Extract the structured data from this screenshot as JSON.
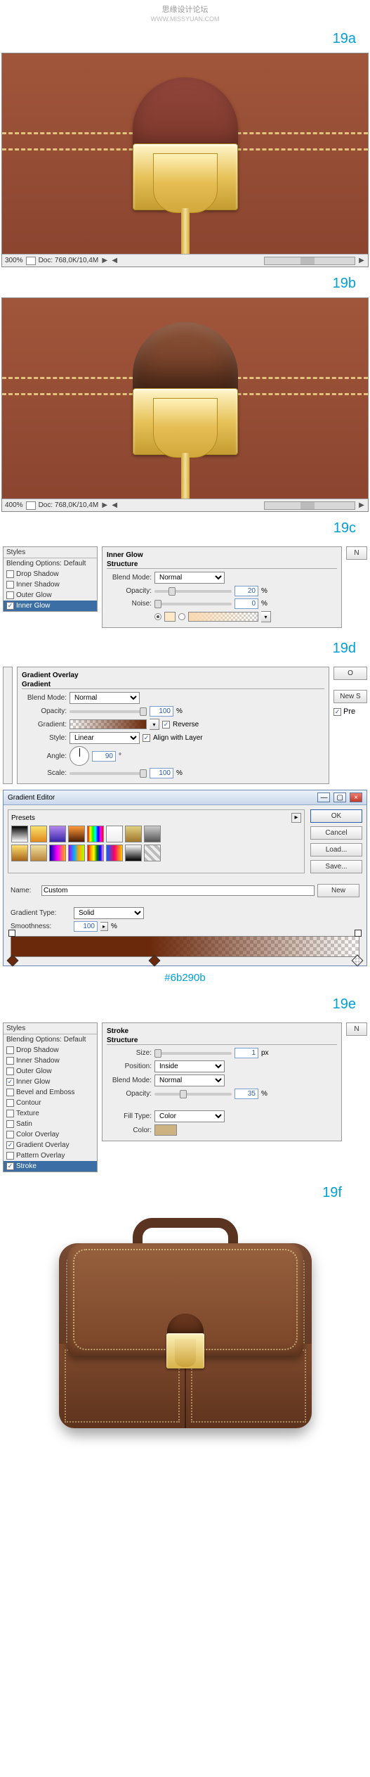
{
  "header": {
    "title": "思缘设计论坛",
    "subtitle": "WWW.MISSYUAN.COM"
  },
  "steps": {
    "a": "19a",
    "b": "19b",
    "c": "19c",
    "d": "19d",
    "e": "19e",
    "f": "19f"
  },
  "canvas_a": {
    "zoom": "300%",
    "doc": "Doc: 768,0K/10,4M"
  },
  "canvas_b": {
    "zoom": "400%",
    "doc": "Doc: 768,0K/10,4M"
  },
  "styles_c": {
    "header": "Styles",
    "items": [
      {
        "label": "Blending Options: Default",
        "checked": false,
        "active": false,
        "has_cb": false
      },
      {
        "label": "Drop Shadow",
        "checked": false,
        "active": false,
        "has_cb": true
      },
      {
        "label": "Inner Shadow",
        "checked": false,
        "active": false,
        "has_cb": true
      },
      {
        "label": "Outer Glow",
        "checked": false,
        "active": false,
        "has_cb": true
      },
      {
        "label": "Inner Glow",
        "checked": true,
        "active": true,
        "has_cb": true
      }
    ]
  },
  "inner_glow": {
    "title": "Inner Glow",
    "structure_label": "Structure",
    "blend_mode_label": "Blend Mode:",
    "blend_mode_value": "Normal",
    "opacity_label": "Opacity:",
    "opacity_value": "20",
    "opacity_unit": "%",
    "noise_label": "Noise:",
    "noise_value": "0",
    "noise_unit": "%",
    "side_btn": "N"
  },
  "grad_overlay": {
    "title": "Gradient Overlay",
    "gradient_label": "Gradient",
    "blend_mode_label": "Blend Mode:",
    "blend_mode_value": "Normal",
    "opacity_label": "Opacity:",
    "opacity_value": "100",
    "opacity_unit": "%",
    "gradient_field_label": "Gradient:",
    "reverse_label": "Reverse",
    "reverse_checked": true,
    "style_label": "Style:",
    "style_value": "Linear",
    "align_label": "Align with Layer",
    "align_checked": true,
    "angle_label": "Angle:",
    "angle_value": "90",
    "angle_unit": "°",
    "scale_label": "Scale:",
    "scale_value": "100",
    "scale_unit": "%",
    "side_ok": "O",
    "side_new": "New S",
    "side_pre": "Pre"
  },
  "grad_editor": {
    "title": "Gradient Editor",
    "presets_label": "Presets",
    "btn_ok": "OK",
    "btn_cancel": "Cancel",
    "btn_load": "Load...",
    "btn_save": "Save...",
    "name_label": "Name:",
    "name_value": "Custom",
    "btn_new": "New",
    "type_label": "Gradient Type:",
    "type_value": "Solid",
    "smooth_label": "Smoothness:",
    "smooth_value": "100",
    "smooth_unit": "%",
    "hex_note": "#6b290b",
    "win_min": "—",
    "win_max": "▢",
    "win_close": "×",
    "preset_gradients": [
      "linear-gradient(#000,#fff)",
      "linear-gradient(#f7e26b,#e08a1e)",
      "linear-gradient(#b387f0,#3826a6)",
      "linear-gradient(#ff9a3c,#4b1e05)",
      "linear-gradient(90deg,#ff0000,#ffff00,#00ff00,#00ffff,#0000ff,#ff00ff,#ff0000)",
      "linear-gradient(#fff,rgba(255,255,255,0))",
      "linear-gradient(#e0d080,#a0762a)",
      "linear-gradient(#ccc,#555)",
      "linear-gradient(#ffe070,#a5651a)",
      "linear-gradient(#f0e0a0,#b8863a)",
      "linear-gradient(90deg,#00a,#f0f,#fa0)",
      "linear-gradient(90deg,#a0f,#0af,#fa0,#af0)",
      "linear-gradient(90deg,red,orange,yellow,green,blue,violet)",
      "linear-gradient(90deg,#06f,#f06,#fc0)",
      "linear-gradient(#fff,#000)",
      "repeating-linear-gradient(45deg,#bbb 0 4px,#eee 4px 8px)"
    ]
  },
  "styles_e": {
    "header": "Styles",
    "items": [
      {
        "label": "Blending Options: Default",
        "checked": false,
        "active": false,
        "has_cb": false
      },
      {
        "label": "Drop Shadow",
        "checked": false,
        "active": false,
        "has_cb": true
      },
      {
        "label": "Inner Shadow",
        "checked": false,
        "active": false,
        "has_cb": true
      },
      {
        "label": "Outer Glow",
        "checked": false,
        "active": false,
        "has_cb": true
      },
      {
        "label": "Inner Glow",
        "checked": true,
        "active": false,
        "has_cb": true
      },
      {
        "label": "Bevel and Emboss",
        "checked": false,
        "active": false,
        "has_cb": true
      },
      {
        "label": "Contour",
        "checked": false,
        "active": false,
        "has_cb": true
      },
      {
        "label": "Texture",
        "checked": false,
        "active": false,
        "has_cb": true
      },
      {
        "label": "Satin",
        "checked": false,
        "active": false,
        "has_cb": true
      },
      {
        "label": "Color Overlay",
        "checked": false,
        "active": false,
        "has_cb": true
      },
      {
        "label": "Gradient Overlay",
        "checked": true,
        "active": false,
        "has_cb": true
      },
      {
        "label": "Pattern Overlay",
        "checked": false,
        "active": false,
        "has_cb": true
      },
      {
        "label": "Stroke",
        "checked": true,
        "active": true,
        "has_cb": true
      }
    ]
  },
  "stroke": {
    "title": "Stroke",
    "structure_label": "Structure",
    "size_label": "Size:",
    "size_value": "1",
    "size_unit": "px",
    "position_label": "Position:",
    "position_value": "Inside",
    "blend_mode_label": "Blend Mode:",
    "blend_mode_value": "Normal",
    "opacity_label": "Opacity:",
    "opacity_value": "35",
    "opacity_unit": "%",
    "fill_type_label": "Fill Type:",
    "fill_type_value": "Color",
    "color_label": "Color:",
    "color_value": "#cdb282",
    "side_btn": "N"
  }
}
